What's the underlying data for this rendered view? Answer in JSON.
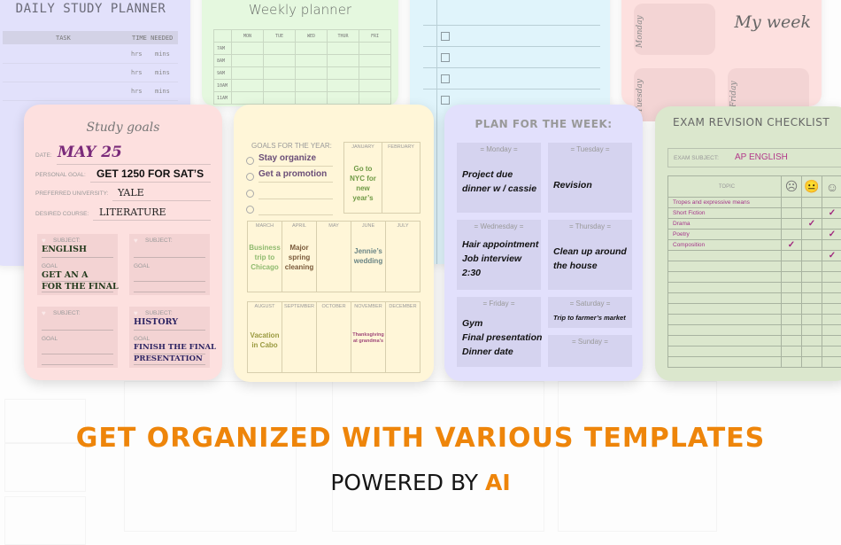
{
  "background_cards": {
    "daily": {
      "title": "DAILY STUDY PLANNER",
      "col_task": "TASK",
      "col_time": "TIME NEEDED",
      "rows": [
        {
          "hrs": "hrs",
          "mins": "mins"
        },
        {
          "hrs": "hrs",
          "mins": "mins"
        },
        {
          "hrs": "hrs",
          "mins": "mins"
        }
      ]
    },
    "weekly": {
      "title": "Weekly planner",
      "days": [
        "MON",
        "TUE",
        "WED",
        "THUR",
        "FRI"
      ],
      "times": [
        "7AM",
        "8AM",
        "9AM",
        "10AM",
        "11AM"
      ]
    },
    "checklist": {
      "checkbox_count": 4
    },
    "my_week": {
      "title": "My week",
      "days": [
        "Monday",
        "Tuesday",
        "Friday"
      ]
    }
  },
  "study_goals": {
    "title": "Study goals",
    "fields": [
      {
        "label": "DATE:",
        "value": "MAY 25"
      },
      {
        "label": "PERSONAL GOAL:",
        "value": "GET 1250 FOR SAT’S"
      },
      {
        "label": "PREFERRED UNIVERSITY:",
        "value": "YALE"
      },
      {
        "label": "DESIRED COURSE:",
        "value": "LITERATURE"
      }
    ],
    "subject_label": "SUBJECT:",
    "goal_label": "GOAL",
    "subjects": [
      {
        "subject": "ENGLISH",
        "goal_line1": "GET AN A",
        "goal_line2": "FOR THE FINAL",
        "color": "#233a1c"
      },
      {
        "subject": "",
        "goal_line1": "",
        "goal_line2": "",
        "color": "#233a1c"
      },
      {
        "subject": "",
        "goal_line1": "",
        "goal_line2": "",
        "color": "#2e2563"
      },
      {
        "subject": "HISTORY",
        "goal_line1": "FINISH THE FINAL",
        "goal_line2": "PRESENTATION",
        "color": "#2e2563"
      }
    ]
  },
  "year_goals": {
    "header": "GOALS FOR THE YEAR:",
    "goals": [
      "Stay organize",
      "Get a promotion",
      "",
      ""
    ],
    "months": [
      {
        "name": "JANUARY",
        "note": "Go to NYC for new year’s",
        "color": "#6f9a45"
      },
      {
        "name": "FEBRUARY",
        "note": "",
        "color": "#777"
      },
      {
        "name": "MARCH",
        "note": "Business trip to Chicago",
        "color": "#8fba6e"
      },
      {
        "name": "APRIL",
        "note": "Major spring cleaning",
        "color": "#7a5a3a"
      },
      {
        "name": "MAY",
        "note": "",
        "color": "#777"
      },
      {
        "name": "JUNE",
        "note": "Jennie’s wedding",
        "color": "#6a8585"
      },
      {
        "name": "JULY",
        "note": "",
        "color": "#777"
      },
      {
        "name": "AUGUST",
        "note": "Vacation in Cabo",
        "color": "#9a9a40"
      },
      {
        "name": "SEPTEMBER",
        "note": "",
        "color": "#777"
      },
      {
        "name": "OCTOBER",
        "note": "",
        "color": "#777"
      },
      {
        "name": "NOVEMBER",
        "note": "Thanksgiving at grandma’s",
        "color": "#a04a7a"
      },
      {
        "name": "DECEMBER",
        "note": "",
        "color": "#777"
      }
    ]
  },
  "plan_week": {
    "title": "PLAN FOR THE WEEK:",
    "days": [
      {
        "name": "Monday",
        "lines": [
          "Project due",
          "dinner w / cassie"
        ]
      },
      {
        "name": "Tuesday",
        "lines": [
          "Revision"
        ]
      },
      {
        "name": "Wednesday",
        "lines": [
          "Hair appointment",
          "Job interview",
          "2:30"
        ]
      },
      {
        "name": "Thursday",
        "lines": [
          "Clean up around",
          "the house"
        ]
      },
      {
        "name": "Friday",
        "lines": [
          "Gym",
          "Final presentation",
          "Dinner date"
        ]
      },
      {
        "name": "Saturday",
        "lines": [
          "Trip to farmer’s market"
        ]
      },
      {
        "name": "Sunday",
        "lines": []
      }
    ]
  },
  "exam": {
    "title": "EXAM REVISION CHECKLIST",
    "subject_label": "EXAM SUBJECT:",
    "subject_value": "AP ENGLISH",
    "topic_header": "TOPIC",
    "ratings": [
      "sad",
      "neutral",
      "happy"
    ],
    "topics": [
      {
        "name": "Tropes and expressive means",
        "rating": ""
      },
      {
        "name": "Short Fiction",
        "rating": "happy"
      },
      {
        "name": "Drama",
        "rating": "neutral"
      },
      {
        "name": "Poetry",
        "rating": "happy"
      },
      {
        "name": "Composition",
        "rating": "sad"
      },
      {
        "name": "",
        "rating": "happy"
      }
    ],
    "empty_rows": 10
  },
  "headline": "GET ORGANIZED WITH VARIOUS TEMPLATES",
  "tagline": {
    "prefix": "POWERED BY ",
    "highlight": "AI"
  },
  "colors": {
    "accent": "#ee850a",
    "text_dark": "#161616"
  }
}
